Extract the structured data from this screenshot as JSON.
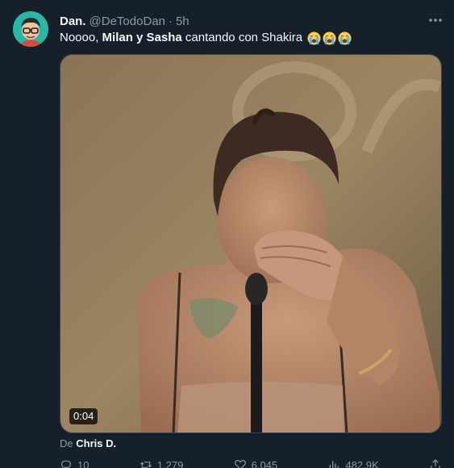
{
  "author": {
    "display_name": "Dan.",
    "handle": "@DeTodoDan",
    "separator": "·",
    "time": "5h"
  },
  "tweet": {
    "text_prefix": "Noooo, ",
    "text_bold": "Milan y Sasha",
    "text_suffix": " cantando con Shakira",
    "emoji": [
      "loudly-crying-face",
      "loudly-crying-face",
      "loudly-crying-face"
    ]
  },
  "media": {
    "duration": "0:04"
  },
  "attribution": {
    "prefix": "De",
    "source": "Chris D."
  },
  "actions": {
    "reply_count": "10",
    "retweet_count": "1,279",
    "like_count": "6,045",
    "views_count": "482.9K"
  },
  "icons": {
    "more": "more-horizontal-icon",
    "reply": "reply-icon",
    "retweet": "retweet-icon",
    "like": "heart-icon",
    "views": "views-icon",
    "share": "share-icon"
  },
  "colors": {
    "background": "#15202b",
    "text": "#f7f9f9",
    "secondary_text": "#8b98a5",
    "border": "#38444d",
    "avatar_bg": "#2bb7a6"
  }
}
